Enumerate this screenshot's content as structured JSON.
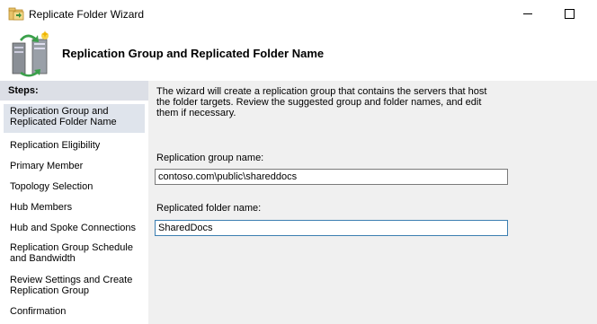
{
  "window": {
    "title": "Replicate Folder Wizard",
    "minimize_icon": "minimize-icon",
    "maximize_icon": "maximize-icon"
  },
  "header": {
    "title": "Replication Group and Replicated Folder Name",
    "icon": "replication-server-icon"
  },
  "steps": {
    "heading": "Steps:",
    "items": [
      {
        "label": "Replication Group and Replicated Folder Name",
        "selected": true
      },
      {
        "label": "Replication Eligibility",
        "selected": false
      },
      {
        "label": "Primary Member",
        "selected": false
      },
      {
        "label": "Topology Selection",
        "selected": false
      },
      {
        "label": "Hub Members",
        "selected": false
      },
      {
        "label": "Hub and Spoke Connections",
        "selected": false
      },
      {
        "label": "Replication Group Schedule and Bandwidth",
        "selected": false
      },
      {
        "label": "Review Settings and Create Replication Group",
        "selected": false
      },
      {
        "label": "Confirmation",
        "selected": false
      }
    ]
  },
  "main": {
    "intro": "The wizard will create a replication group that contains the servers that host the folder targets. Review the suggested group and folder names, and edit them if necessary.",
    "group_name_label": "Replication group name:",
    "group_name_value": "contoso.com\\public\\shareddocs",
    "folder_name_label": "Replicated folder name:",
    "folder_name_value": "SharedDocs"
  },
  "colors": {
    "steps_header_bg": "#dcdfe6",
    "selected_step_bg": "#dfe4ec",
    "content_bg": "#f0f0f0",
    "focus_border": "#3c7fb1"
  }
}
